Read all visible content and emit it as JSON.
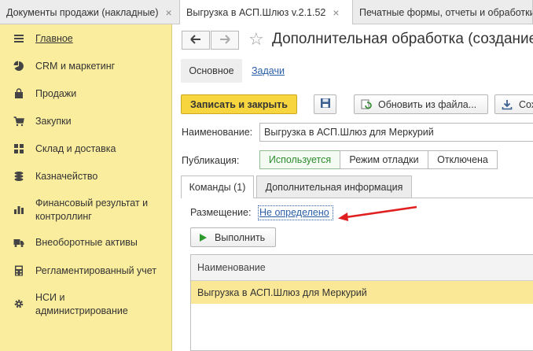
{
  "tabs": [
    {
      "label": "Документы продажи (накладные)",
      "close": "×"
    },
    {
      "label": "Выгрузка в АСП.Шлюз v.2.1.52",
      "close": "×"
    },
    {
      "label": "Печатные формы, отчеты и обработки"
    }
  ],
  "sidebar": {
    "items": [
      {
        "label": "Главное",
        "icon": "menu-lines-icon"
      },
      {
        "label": "CRM и маркетинг",
        "icon": "pie-chart-icon"
      },
      {
        "label": "Продажи",
        "icon": "shopping-bag-icon"
      },
      {
        "label": "Закупки",
        "icon": "cart-icon"
      },
      {
        "label": "Склад и доставка",
        "icon": "warehouse-grid-icon"
      },
      {
        "label": "Казначейство",
        "icon": "coins-stack-icon"
      },
      {
        "label": "Финансовый результат и контроллинг",
        "icon": "bar-chart-icon"
      },
      {
        "label": "Внеоборотные активы",
        "icon": "truck-icon"
      },
      {
        "label": "Регламентированный учет",
        "icon": "calculator-icon"
      },
      {
        "label": "НСИ и администрирование",
        "icon": "gear-icon"
      }
    ]
  },
  "header": {
    "title": "Дополнительная обработка (создание)",
    "back_icon": "arrow-left-icon",
    "forward_icon": "arrow-right-icon",
    "star_icon": "star-icon"
  },
  "subtabs": {
    "main": "Основное",
    "tasks": "Задачи"
  },
  "toolbar": {
    "save_close": "Записать и закрыть",
    "save_icon": "floppy-icon",
    "update_from_file": "Обновить из файла...",
    "save_to_file": "Сох"
  },
  "form": {
    "name_label": "Наименование:",
    "name_value": "Выгрузка в АСП.Шлюз для Меркурий",
    "publication_label": "Публикация:",
    "publication_options": [
      "Используется",
      "Режим отладки",
      "Отключена"
    ],
    "publication_selected": "Используется"
  },
  "panel_tabs": {
    "commands": "Команды (1)",
    "additional": "Дополнительная информация"
  },
  "commands": {
    "placement_label": "Размещение:",
    "placement_value": "Не определено",
    "run_button": "Выполнить",
    "grid_header": "Наименование",
    "rows": [
      "Выгрузка в АСП.Шлюз для Меркурий"
    ]
  },
  "colors": {
    "sidebar": "#fbed9e",
    "accent_button": "#f6d53e",
    "selected_row": "#fbe896",
    "link": "#2a5fa8",
    "annotation_arrow": "#e02020"
  }
}
